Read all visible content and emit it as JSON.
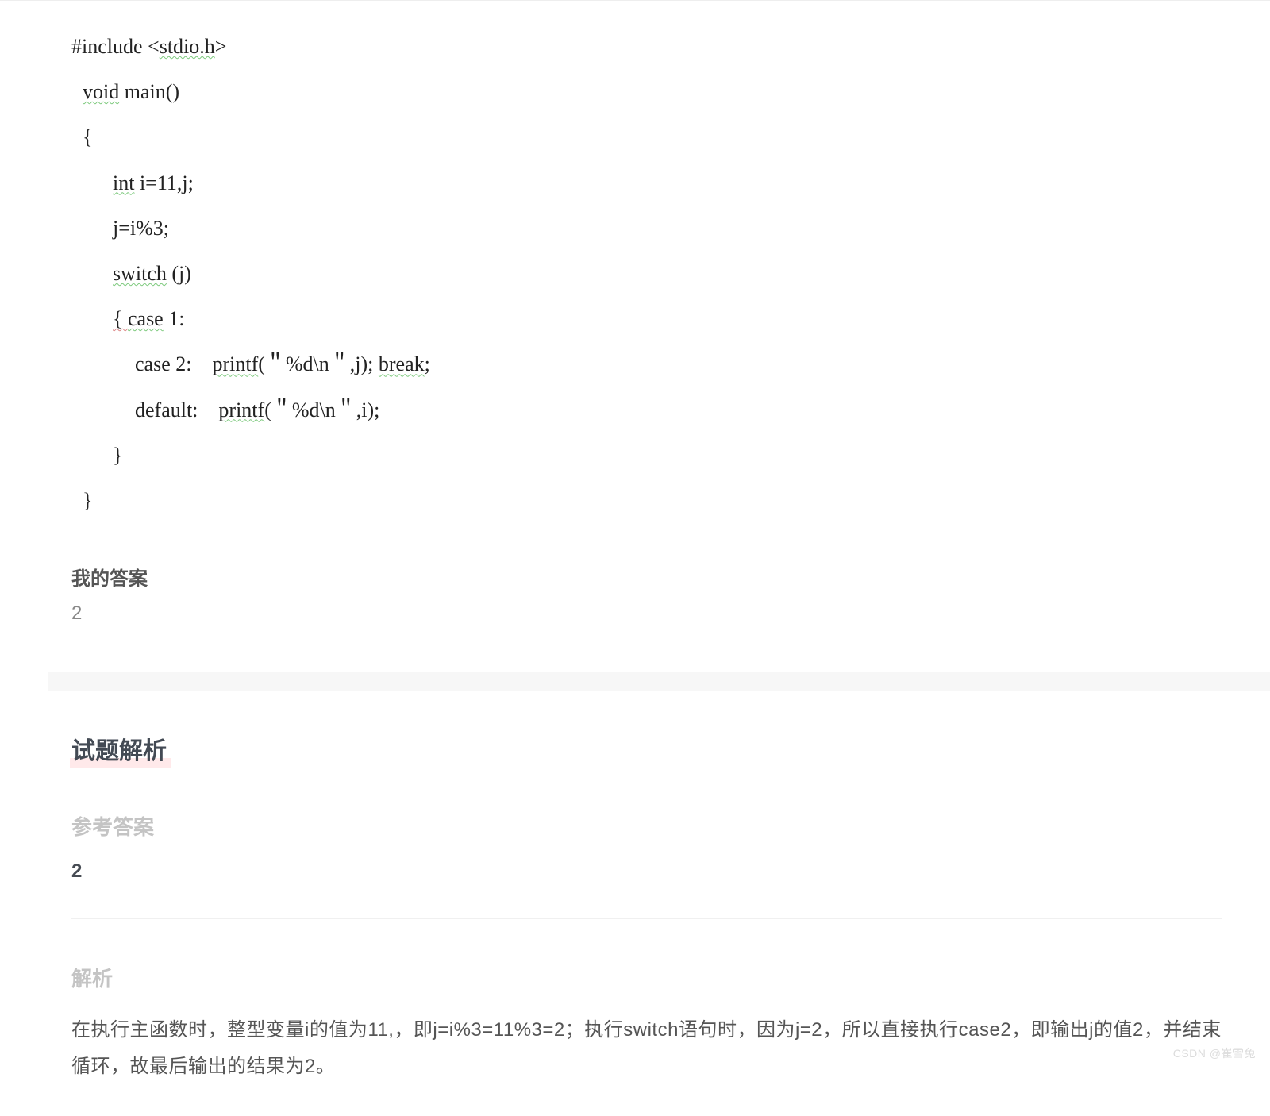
{
  "code": {
    "l1_a": "#include <",
    "l1_b": "stdio.h",
    "l1_c": ">",
    "l2_a": "void",
    "l2_b": " main()",
    "l3": "{",
    "l4_a": "int",
    "l4_b": " i=11,j;",
    "l5": "j=i%3;",
    "l6_a": "switch",
    "l6_b": " (j)",
    "l7_a": "{ ",
    "l7_b": "case",
    "l7_c": " 1:",
    "l8_a": "case 2:    ",
    "l8_b": "printf",
    "l8_c": "(＂%d\\n＂,j); ",
    "l8_d": "break",
    "l8_e": ";",
    "l9_a": "default:    ",
    "l9_b": "printf",
    "l9_c": "(＂%d\\n＂,i);",
    "l10": "}",
    "l11": "}"
  },
  "my_answer": {
    "label": "我的答案",
    "value": "2"
  },
  "analysis": {
    "heading": "试题解析",
    "ref_answer_label": "参考答案",
    "ref_answer_value": "2",
    "explanation_label": "解析",
    "explanation_text": "在执行主函数时，整型变量i的值为11,，即j=i%3=11%3=2；执行switch语句时，因为j=2，所以直接执行case2，即输出j的值2，并结束循环，故最后输出的结果为2。"
  },
  "watermark": "CSDN @崔雪兔"
}
